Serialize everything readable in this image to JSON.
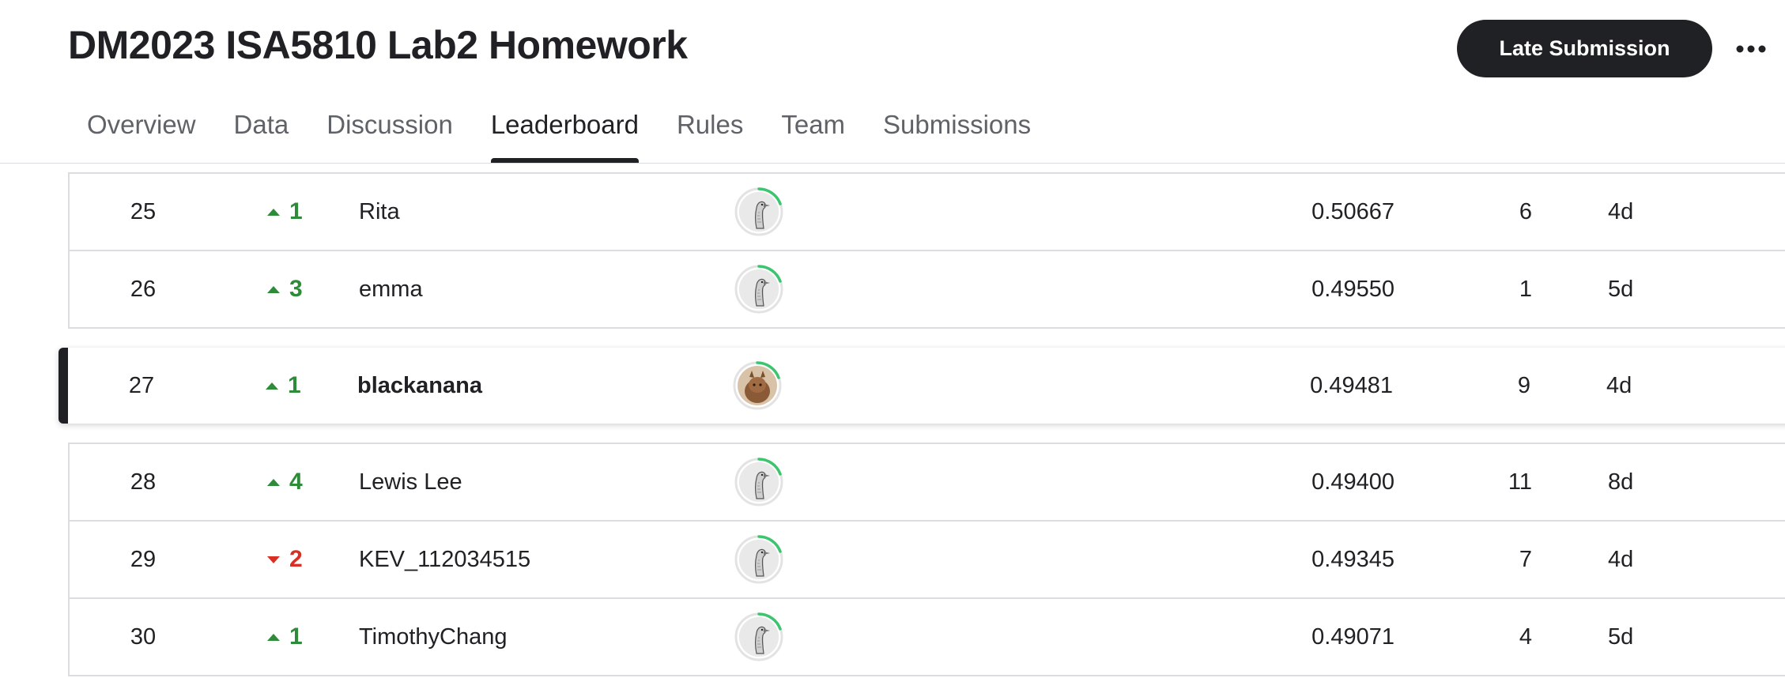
{
  "header": {
    "title": "DM2023 ISA5810 Lab2 Homework",
    "late_submission_label": "Late Submission",
    "more_icon": "more-horizontal-icon"
  },
  "tabs": [
    {
      "label": "Overview"
    },
    {
      "label": "Data"
    },
    {
      "label": "Discussion"
    },
    {
      "label": "Leaderboard",
      "active": true
    },
    {
      "label": "Rules"
    },
    {
      "label": "Team"
    },
    {
      "label": "Submissions"
    }
  ],
  "colors": {
    "up": "#2e8b3a",
    "down": "#d93025",
    "accent_ring": "#3cc46e",
    "dark": "#202124"
  },
  "leaderboard": {
    "rows_above": [
      {
        "rank": "25",
        "direction": "up",
        "change": "1",
        "name": "Rita",
        "score": "0.50667",
        "entries": "6",
        "last": "4d"
      },
      {
        "rank": "26",
        "direction": "up",
        "change": "3",
        "name": "emma",
        "score": "0.49550",
        "entries": "1",
        "last": "5d"
      }
    ],
    "current_user": {
      "rank": "27",
      "direction": "up",
      "change": "1",
      "name": "blackanana",
      "score": "0.49481",
      "entries": "9",
      "last": "4d"
    },
    "rows_below": [
      {
        "rank": "28",
        "direction": "up",
        "change": "4",
        "name": "Lewis Lee",
        "score": "0.49400",
        "entries": "11",
        "last": "8d"
      },
      {
        "rank": "29",
        "direction": "down",
        "change": "2",
        "name": "KEV_112034515",
        "score": "0.49345",
        "entries": "7",
        "last": "4d"
      },
      {
        "rank": "30",
        "direction": "up",
        "change": "1",
        "name": "TimothyChang",
        "score": "0.49071",
        "entries": "4",
        "last": "5d"
      }
    ]
  }
}
